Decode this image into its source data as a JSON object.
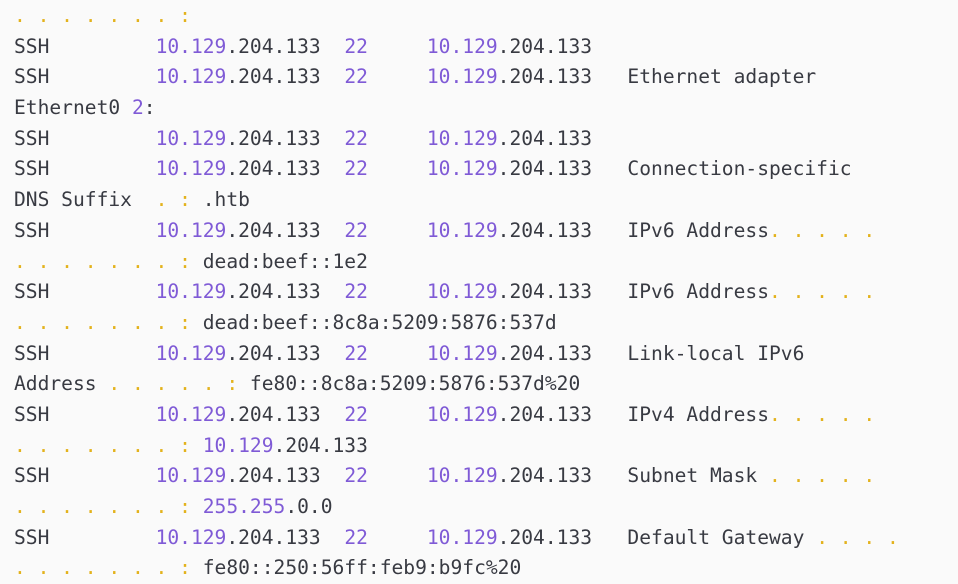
{
  "colors": {
    "background": "#fafafa",
    "text": "#383a42",
    "number": "#7f5ad6",
    "dots": "#e3b21c"
  },
  "lines": [
    [
      {
        "t": ". . . . . . . :",
        "c": "dots"
      }
    ],
    [
      {
        "t": "SSH         ",
        "c": "plain"
      },
      {
        "t": "10.129",
        "c": "num"
      },
      {
        "t": ".204.133  ",
        "c": "plain"
      },
      {
        "t": "22",
        "c": "num"
      },
      {
        "t": "     ",
        "c": "plain"
      },
      {
        "t": "10.129",
        "c": "num"
      },
      {
        "t": ".204.133",
        "c": "plain"
      }
    ],
    [
      {
        "t": "SSH         ",
        "c": "plain"
      },
      {
        "t": "10.129",
        "c": "num"
      },
      {
        "t": ".204.133  ",
        "c": "plain"
      },
      {
        "t": "22",
        "c": "num"
      },
      {
        "t": "     ",
        "c": "plain"
      },
      {
        "t": "10.129",
        "c": "num"
      },
      {
        "t": ".204.133   Ethernet adapter",
        "c": "plain"
      }
    ],
    [
      {
        "t": "Ethernet0 ",
        "c": "plain"
      },
      {
        "t": "2",
        "c": "num"
      },
      {
        "t": ":",
        "c": "plain"
      }
    ],
    [
      {
        "t": "SSH         ",
        "c": "plain"
      },
      {
        "t": "10.129",
        "c": "num"
      },
      {
        "t": ".204.133  ",
        "c": "plain"
      },
      {
        "t": "22",
        "c": "num"
      },
      {
        "t": "     ",
        "c": "plain"
      },
      {
        "t": "10.129",
        "c": "num"
      },
      {
        "t": ".204.133",
        "c": "plain"
      }
    ],
    [
      {
        "t": "SSH         ",
        "c": "plain"
      },
      {
        "t": "10.129",
        "c": "num"
      },
      {
        "t": ".204.133  ",
        "c": "plain"
      },
      {
        "t": "22",
        "c": "num"
      },
      {
        "t": "     ",
        "c": "plain"
      },
      {
        "t": "10.129",
        "c": "num"
      },
      {
        "t": ".204.133   Connection-specific",
        "c": "plain"
      }
    ],
    [
      {
        "t": "DNS Suffix  ",
        "c": "plain"
      },
      {
        "t": ". :",
        "c": "dots"
      },
      {
        "t": " .htb",
        "c": "plain"
      }
    ],
    [
      {
        "t": "SSH         ",
        "c": "plain"
      },
      {
        "t": "10.129",
        "c": "num"
      },
      {
        "t": ".204.133  ",
        "c": "plain"
      },
      {
        "t": "22",
        "c": "num"
      },
      {
        "t": "     ",
        "c": "plain"
      },
      {
        "t": "10.129",
        "c": "num"
      },
      {
        "t": ".204.133   IPv6 Address",
        "c": "plain"
      },
      {
        "t": ". . . . .",
        "c": "dots"
      }
    ],
    [
      {
        "t": ". . . . . . . :",
        "c": "dots"
      },
      {
        "t": " dead:beef::1e2",
        "c": "plain"
      }
    ],
    [
      {
        "t": "SSH         ",
        "c": "plain"
      },
      {
        "t": "10.129",
        "c": "num"
      },
      {
        "t": ".204.133  ",
        "c": "plain"
      },
      {
        "t": "22",
        "c": "num"
      },
      {
        "t": "     ",
        "c": "plain"
      },
      {
        "t": "10.129",
        "c": "num"
      },
      {
        "t": ".204.133   IPv6 Address",
        "c": "plain"
      },
      {
        "t": ". . . . .",
        "c": "dots"
      }
    ],
    [
      {
        "t": ". . . . . . . :",
        "c": "dots"
      },
      {
        "t": " dead:beef::8c8a:5209:5876:537d",
        "c": "plain"
      }
    ],
    [
      {
        "t": "SSH         ",
        "c": "plain"
      },
      {
        "t": "10.129",
        "c": "num"
      },
      {
        "t": ".204.133  ",
        "c": "plain"
      },
      {
        "t": "22",
        "c": "num"
      },
      {
        "t": "     ",
        "c": "plain"
      },
      {
        "t": "10.129",
        "c": "num"
      },
      {
        "t": ".204.133   Link-local IPv6",
        "c": "plain"
      }
    ],
    [
      {
        "t": "Address ",
        "c": "plain"
      },
      {
        "t": ". . . . . :",
        "c": "dots"
      },
      {
        "t": " fe80::8c8a:5209:5876:537d%20",
        "c": "plain"
      }
    ],
    [
      {
        "t": "SSH         ",
        "c": "plain"
      },
      {
        "t": "10.129",
        "c": "num"
      },
      {
        "t": ".204.133  ",
        "c": "plain"
      },
      {
        "t": "22",
        "c": "num"
      },
      {
        "t": "     ",
        "c": "plain"
      },
      {
        "t": "10.129",
        "c": "num"
      },
      {
        "t": ".204.133   IPv4 Address",
        "c": "plain"
      },
      {
        "t": ". . . . .",
        "c": "dots"
      }
    ],
    [
      {
        "t": ". . . . . . . :",
        "c": "dots"
      },
      {
        "t": " ",
        "c": "plain"
      },
      {
        "t": "10.129",
        "c": "num"
      },
      {
        "t": ".204.133",
        "c": "plain"
      }
    ],
    [
      {
        "t": "SSH         ",
        "c": "plain"
      },
      {
        "t": "10.129",
        "c": "num"
      },
      {
        "t": ".204.133  ",
        "c": "plain"
      },
      {
        "t": "22",
        "c": "num"
      },
      {
        "t": "     ",
        "c": "plain"
      },
      {
        "t": "10.129",
        "c": "num"
      },
      {
        "t": ".204.133   Subnet Mask ",
        "c": "plain"
      },
      {
        "t": ". . . . .",
        "c": "dots"
      }
    ],
    [
      {
        "t": ". . . . . . . :",
        "c": "dots"
      },
      {
        "t": " ",
        "c": "plain"
      },
      {
        "t": "255.255",
        "c": "num"
      },
      {
        "t": ".0.0",
        "c": "plain"
      }
    ],
    [
      {
        "t": "SSH         ",
        "c": "plain"
      },
      {
        "t": "10.129",
        "c": "num"
      },
      {
        "t": ".204.133  ",
        "c": "plain"
      },
      {
        "t": "22",
        "c": "num"
      },
      {
        "t": "     ",
        "c": "plain"
      },
      {
        "t": "10.129",
        "c": "num"
      },
      {
        "t": ".204.133   Default Gateway ",
        "c": "plain"
      },
      {
        "t": ". . . .",
        "c": "dots"
      }
    ],
    [
      {
        "t": ". . . . . . . :",
        "c": "dots"
      },
      {
        "t": " fe80::250:56ff:feb9:b9fc%20",
        "c": "plain"
      }
    ]
  ]
}
